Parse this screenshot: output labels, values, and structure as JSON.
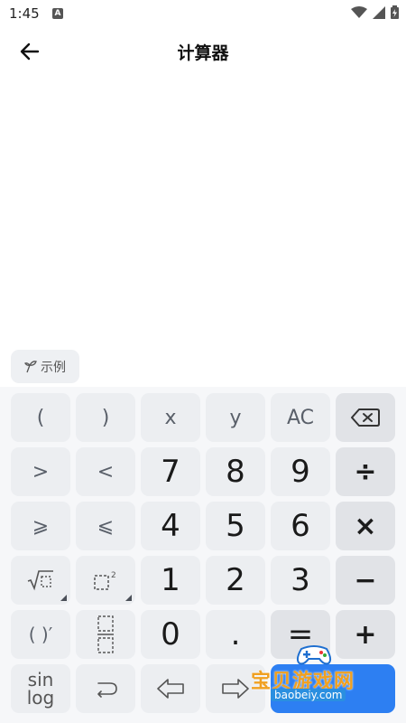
{
  "status": {
    "time": "1:45"
  },
  "header": {
    "title": "计算器"
  },
  "example": {
    "label": "示例"
  },
  "keys": {
    "paren_open": "(",
    "paren_close": ")",
    "x": "x",
    "y": "y",
    "ac": "AC",
    "gt": ">",
    "lt": "<",
    "gte": "⩾",
    "lte": "⩽",
    "d7": "7",
    "d8": "8",
    "d9": "9",
    "d4": "4",
    "d5": "5",
    "d6": "6",
    "d1": "1",
    "d2": "2",
    "d3": "3",
    "d0": "0",
    "dot": ".",
    "divide": "÷",
    "multiply": "×",
    "minus": "−",
    "plus": "+",
    "equals": "=",
    "derivative": "( )′",
    "sin": "sin",
    "log": "log"
  },
  "watermark": {
    "title": "宝贝游戏网",
    "url": "baobeiy.com"
  }
}
